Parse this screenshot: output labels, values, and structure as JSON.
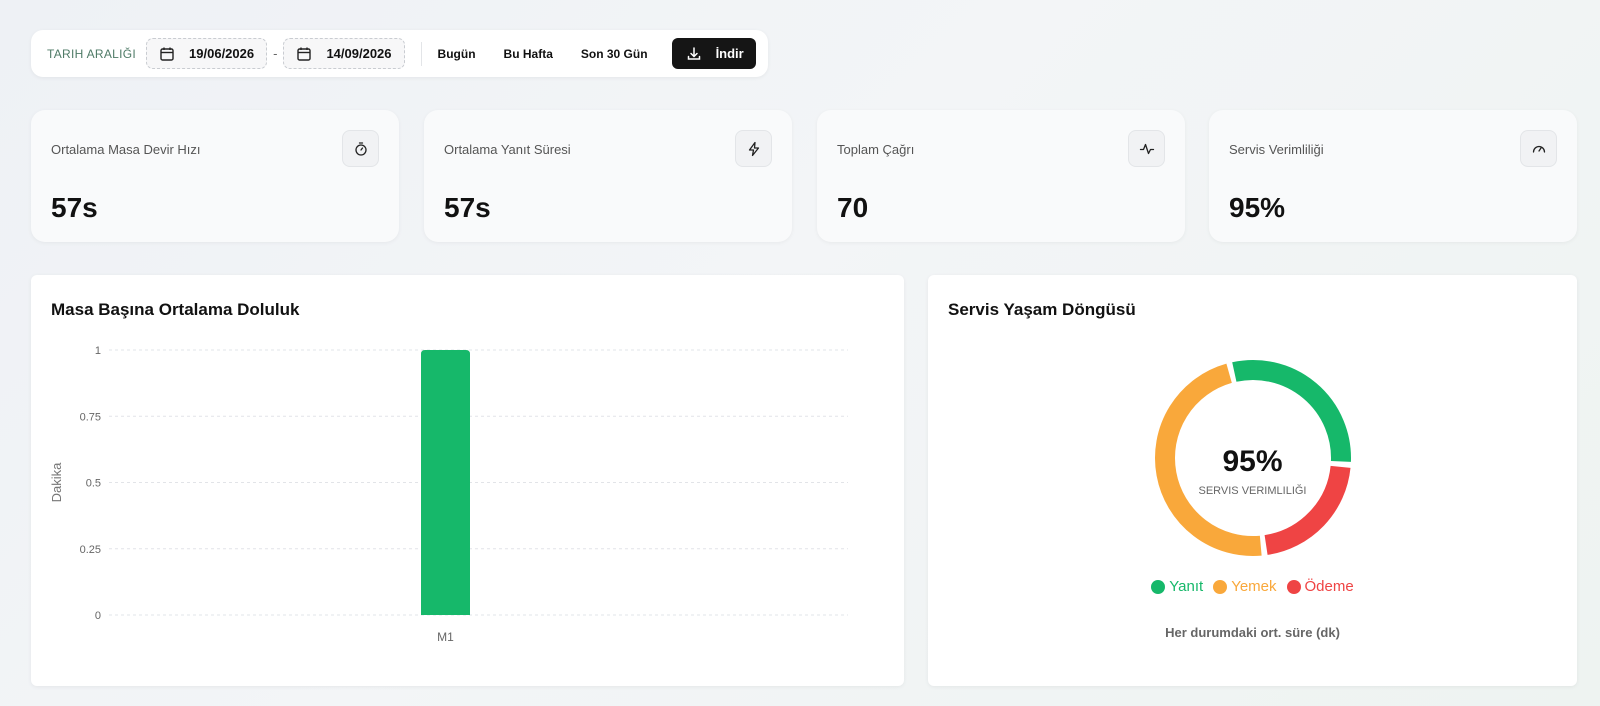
{
  "toolbar": {
    "range_label": "TARIH ARALIĞI",
    "start_date": "19/06/2026",
    "end_date": "14/09/2026",
    "separator": "-",
    "quick_ranges": [
      "Bugün",
      "Bu Hafta",
      "Son 30 Gün"
    ],
    "download_label": "İndir"
  },
  "stats": [
    {
      "label": "Ortalama Masa Devir Hızı",
      "value": "57s",
      "icon": "stopwatch-icon"
    },
    {
      "label": "Ortalama Yanıt Süresi",
      "value": "57s",
      "icon": "lightning-icon"
    },
    {
      "label": "Toplam Çağrı",
      "value": "70",
      "icon": "activity-icon"
    },
    {
      "label": "Servis Verimliliği",
      "value": "95%",
      "icon": "gauge-icon"
    }
  ],
  "occupancy_panel": {
    "title": "Masa Başına Ortalama Doluluk"
  },
  "lifecycle_panel": {
    "title": "Servis Yaşam Döngüsü",
    "center_value": "95%",
    "center_label": "SERVIS VERIMLILIĞI",
    "footnote": "Her durumdaki ort. süre (dk)"
  },
  "colors": {
    "green": "#16b86a",
    "orange": "#f9a83b",
    "red": "#ef4444"
  },
  "chart_data": [
    {
      "type": "bar",
      "categories": [
        "M1"
      ],
      "values": [
        1
      ],
      "ylabel": "Dakika",
      "ylim": [
        0,
        1
      ],
      "yticks": [
        "0",
        "0.25",
        "0.5",
        "0.75",
        "1"
      ],
      "grid": true,
      "color": "#16b86a"
    },
    {
      "type": "pie",
      "donut": true,
      "series": [
        {
          "name": "Yanıt",
          "value": 30,
          "color": "#16b86a"
        },
        {
          "name": "Yemek",
          "value": 48,
          "color": "#f9a83b"
        },
        {
          "name": "Ödeme",
          "value": 22,
          "color": "#ef4444"
        }
      ],
      "legend": "bottom"
    }
  ]
}
